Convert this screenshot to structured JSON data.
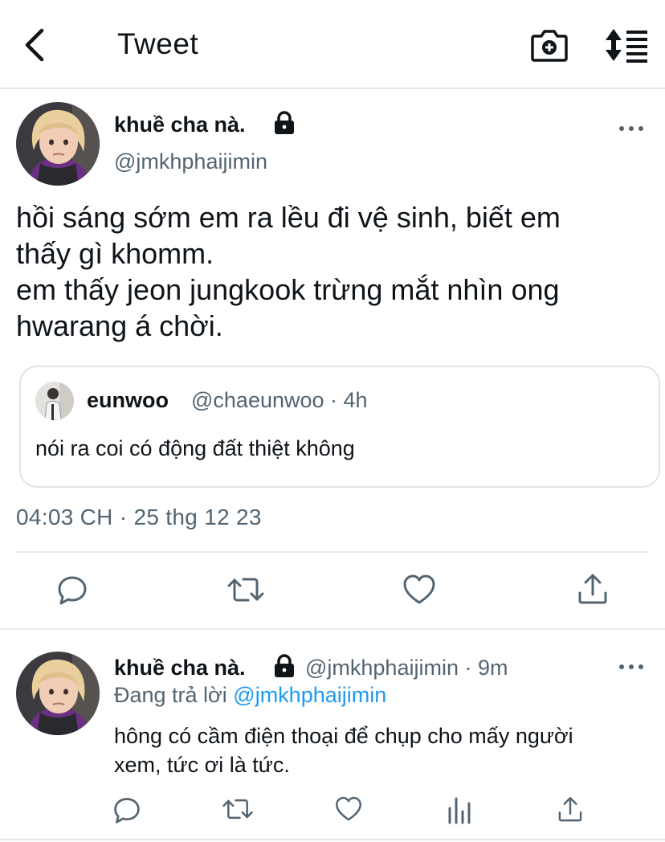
{
  "header": {
    "title": "Tweet",
    "back_icon": "chevron-left-icon",
    "camera_icon": "camera-plus-icon",
    "sort_icon": "sort-list-icon"
  },
  "main_tweet": {
    "display_name": "khuề cha nà.",
    "handle": "@jmkhphaijimin",
    "protected": true,
    "text_lines": [
      "hồi sáng sớm em ra lều đi vệ sinh, biết em",
      "thấy gì khomm.",
      "em thấy jeon jungkook trừng mắt nhìn ong",
      "hwarang á chời."
    ],
    "quote": {
      "display_name": "eunwoo",
      "meta": "@chaeunwoo · 4h",
      "text": "nói ra coi có động đất thiệt không"
    },
    "timestamp": "04:03 CH · 25 thg 12 23"
  },
  "reply_tweet": {
    "display_name": "khuề cha nà.",
    "meta": "@jmkhphaijimin · 9m",
    "protected": true,
    "replying_prefix": "Đang trả lời",
    "replying_handle": "@jmkhphaijimin",
    "text_lines": [
      "hông có cầm điện thoại để chụp cho mấy người",
      "xem, tức ơi là tức."
    ]
  },
  "colors": {
    "text_primary": "#0f1419",
    "text_secondary": "#536471",
    "link": "#1d9bf0",
    "divider": "#e6ebee"
  }
}
